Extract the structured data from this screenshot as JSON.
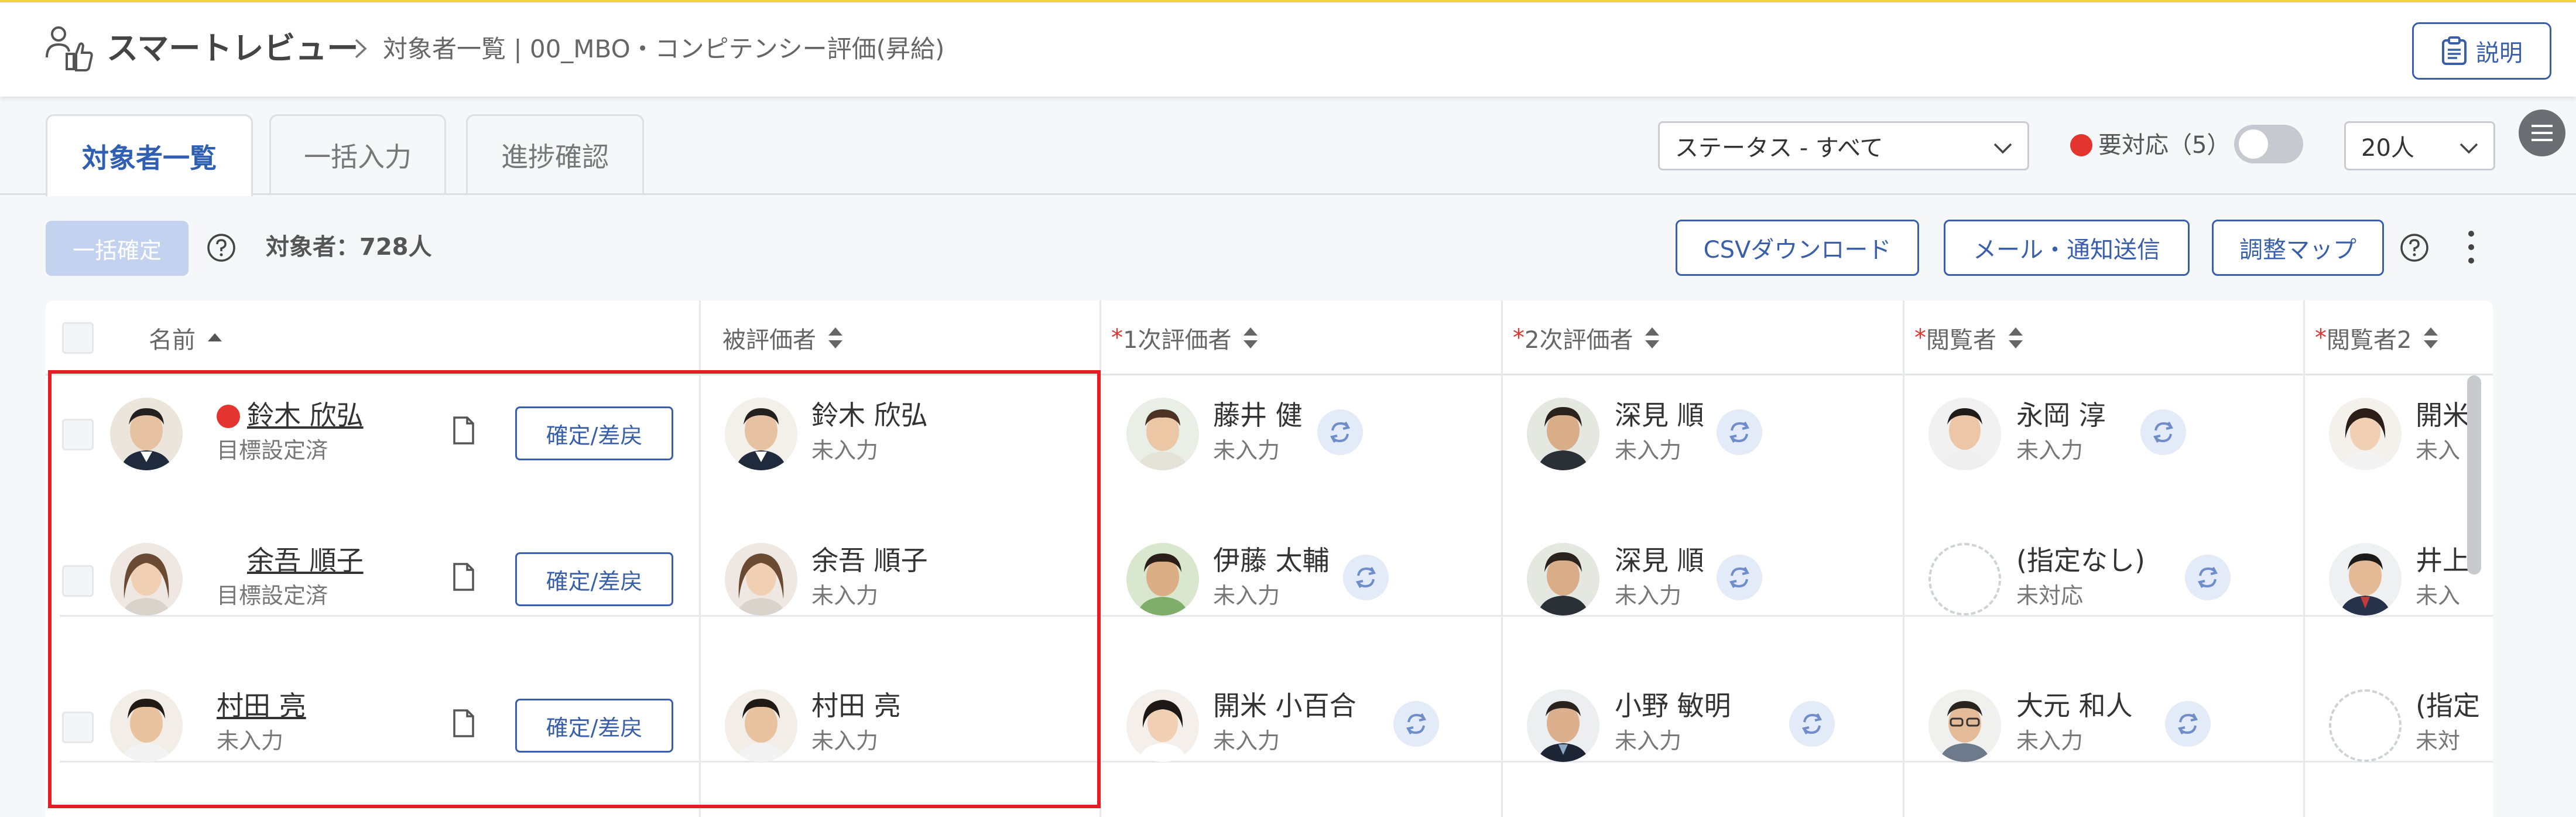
{
  "header": {
    "app_title": "スマートレビュー",
    "breadcrumb": "対象者一覧 | 00_MBO・コンピテンシー評価(昇給)",
    "help_button": "説明"
  },
  "tabs": [
    {
      "label": "対象者一覧",
      "active": true
    },
    {
      "label": "一括入力",
      "active": false
    },
    {
      "label": "進捗確認",
      "active": false
    }
  ],
  "filters": {
    "status_select": "ステータス - すべて",
    "needs_action_label": "要対応（5）",
    "needs_action_toggle": false,
    "page_size_select": "20人"
  },
  "toolbar": {
    "bulk_confirm": "一括確定",
    "target_count": "対象者：728人",
    "csv_download": "CSVダウンロード",
    "mail_notify": "メール・通知送信",
    "adjust_map": "調整マップ"
  },
  "table": {
    "columns": [
      {
        "label": "名前",
        "required": false,
        "sort": "asc"
      },
      {
        "label": "被評価者",
        "required": false,
        "sort": "both"
      },
      {
        "label": "1次評価者",
        "required": true,
        "sort": "both"
      },
      {
        "label": "2次評価者",
        "required": true,
        "sort": "both"
      },
      {
        "label": "閲覧者",
        "required": true,
        "sort": "both"
      },
      {
        "label": "閲覧者2",
        "required": true,
        "sort": "both"
      }
    ],
    "row_action": "確定/差戻",
    "rows": [
      {
        "name": "鈴木 欣弘",
        "status": "目標設定済",
        "alert": true,
        "evaluatee": {
          "name": "鈴木 欣弘",
          "status": "未入力"
        },
        "first": {
          "name": "藤井 健",
          "status": "未入力"
        },
        "second": {
          "name": "深見 順",
          "status": "未入力"
        },
        "viewer": {
          "name": "永岡 淳",
          "status": "未入力"
        },
        "viewer2": {
          "name": "開米",
          "status": "未入"
        }
      },
      {
        "name": "余吾 順子",
        "status": "目標設定済",
        "alert": false,
        "evaluatee": {
          "name": "余吾 順子",
          "status": "未入力"
        },
        "first": {
          "name": "伊藤 太輔",
          "status": "未入力"
        },
        "second": {
          "name": "深見 順",
          "status": "未入力"
        },
        "viewer": {
          "name": "(指定なし)",
          "status": "未対応"
        },
        "viewer2": {
          "name": "井上",
          "status": "未入"
        }
      },
      {
        "name": "村田 亮",
        "status": "未入力",
        "alert": false,
        "evaluatee": {
          "name": "村田 亮",
          "status": "未入力"
        },
        "first": {
          "name": "開米 小百合",
          "status": "未入力"
        },
        "second": {
          "name": "小野 敏明",
          "status": "未入力"
        },
        "viewer": {
          "name": "大元 和人",
          "status": "未入力"
        },
        "viewer2": {
          "name": "(指定",
          "status": "未対"
        }
      }
    ]
  },
  "colors": {
    "accent": "#3a5faa",
    "alert": "#e3342f",
    "highlight_frame": "#e51c23",
    "top_bar": "#f5d43c"
  }
}
